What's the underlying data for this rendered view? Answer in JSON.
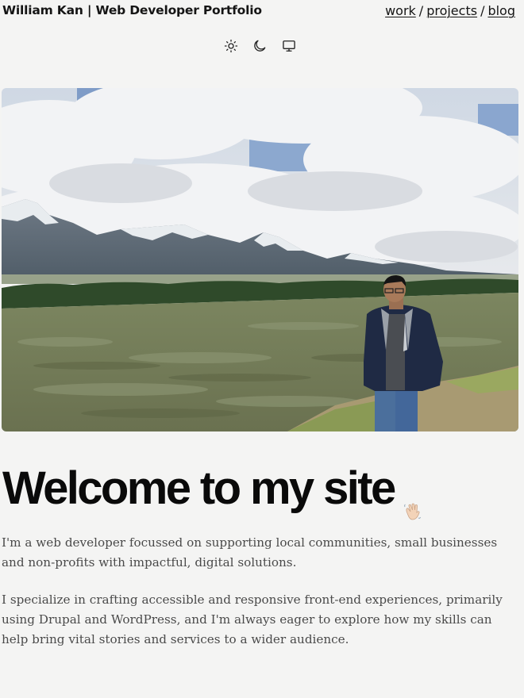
{
  "header": {
    "site_title": "William Kan | Web Developer Portfolio",
    "nav": [
      {
        "label": "work"
      },
      {
        "label": "projects"
      },
      {
        "label": "blog"
      }
    ],
    "nav_separator": "/"
  },
  "theme_toggles": [
    {
      "icon": "sun-icon"
    },
    {
      "icon": "moon-icon"
    },
    {
      "icon": "monitor-icon"
    }
  ],
  "hero": {
    "icon": "hero-photo"
  },
  "main": {
    "heading": "Welcome to my site",
    "heading_emoji_icon": "waving-hand-icon",
    "paragraphs": [
      "I'm a web developer focussed on supporting local communities, small businesses and non-profits with impactful, digital solutions.",
      "I specialize in crafting accessible and responsive front-end experiences, primarily using Drupal and WordPress, and I'm always eager to explore how my skills can help bring vital stories and services to a wider audience."
    ]
  },
  "colors": {
    "background": "#f4f4f3",
    "text": "#111111",
    "body_text": "#4a4a4a"
  }
}
